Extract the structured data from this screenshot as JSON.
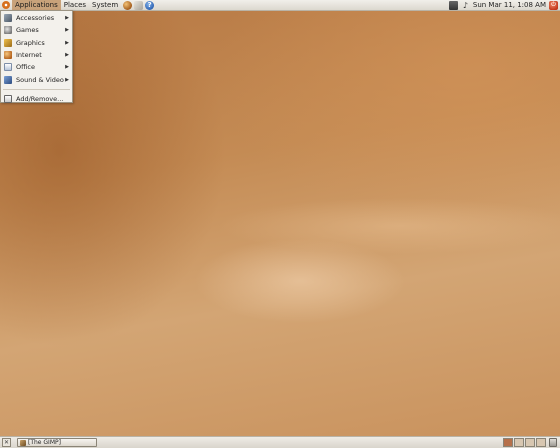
{
  "top_panel": {
    "menus": [
      "Applications",
      "Places",
      "System"
    ],
    "launchers": [
      "web-browser",
      "email",
      "help"
    ],
    "tray": {
      "clock": "Sun Mar 11,  1:08 AM"
    }
  },
  "applications_menu": {
    "items": [
      {
        "label": "Accessories",
        "icon": "accessories-icon",
        "submenu": true
      },
      {
        "label": "Games",
        "icon": "games-icon",
        "submenu": true
      },
      {
        "label": "Graphics",
        "icon": "graphics-icon",
        "submenu": true
      },
      {
        "label": "Internet",
        "icon": "internet-icon",
        "submenu": true
      },
      {
        "label": "Office",
        "icon": "office-icon",
        "submenu": true
      },
      {
        "label": "Sound & Video",
        "icon": "sound-video-icon",
        "submenu": true
      }
    ],
    "footer_item": {
      "label": "Add/Remove...",
      "icon": "add-remove-icon"
    }
  },
  "bottom_panel": {
    "tasks": [
      {
        "label": "[The GIMP]"
      }
    ],
    "workspaces": 4,
    "active_workspace": 1
  },
  "colors": {
    "panel": "#e6e3dc",
    "menu_highlight": "#c8a27a",
    "desktop": "#c48b54"
  }
}
